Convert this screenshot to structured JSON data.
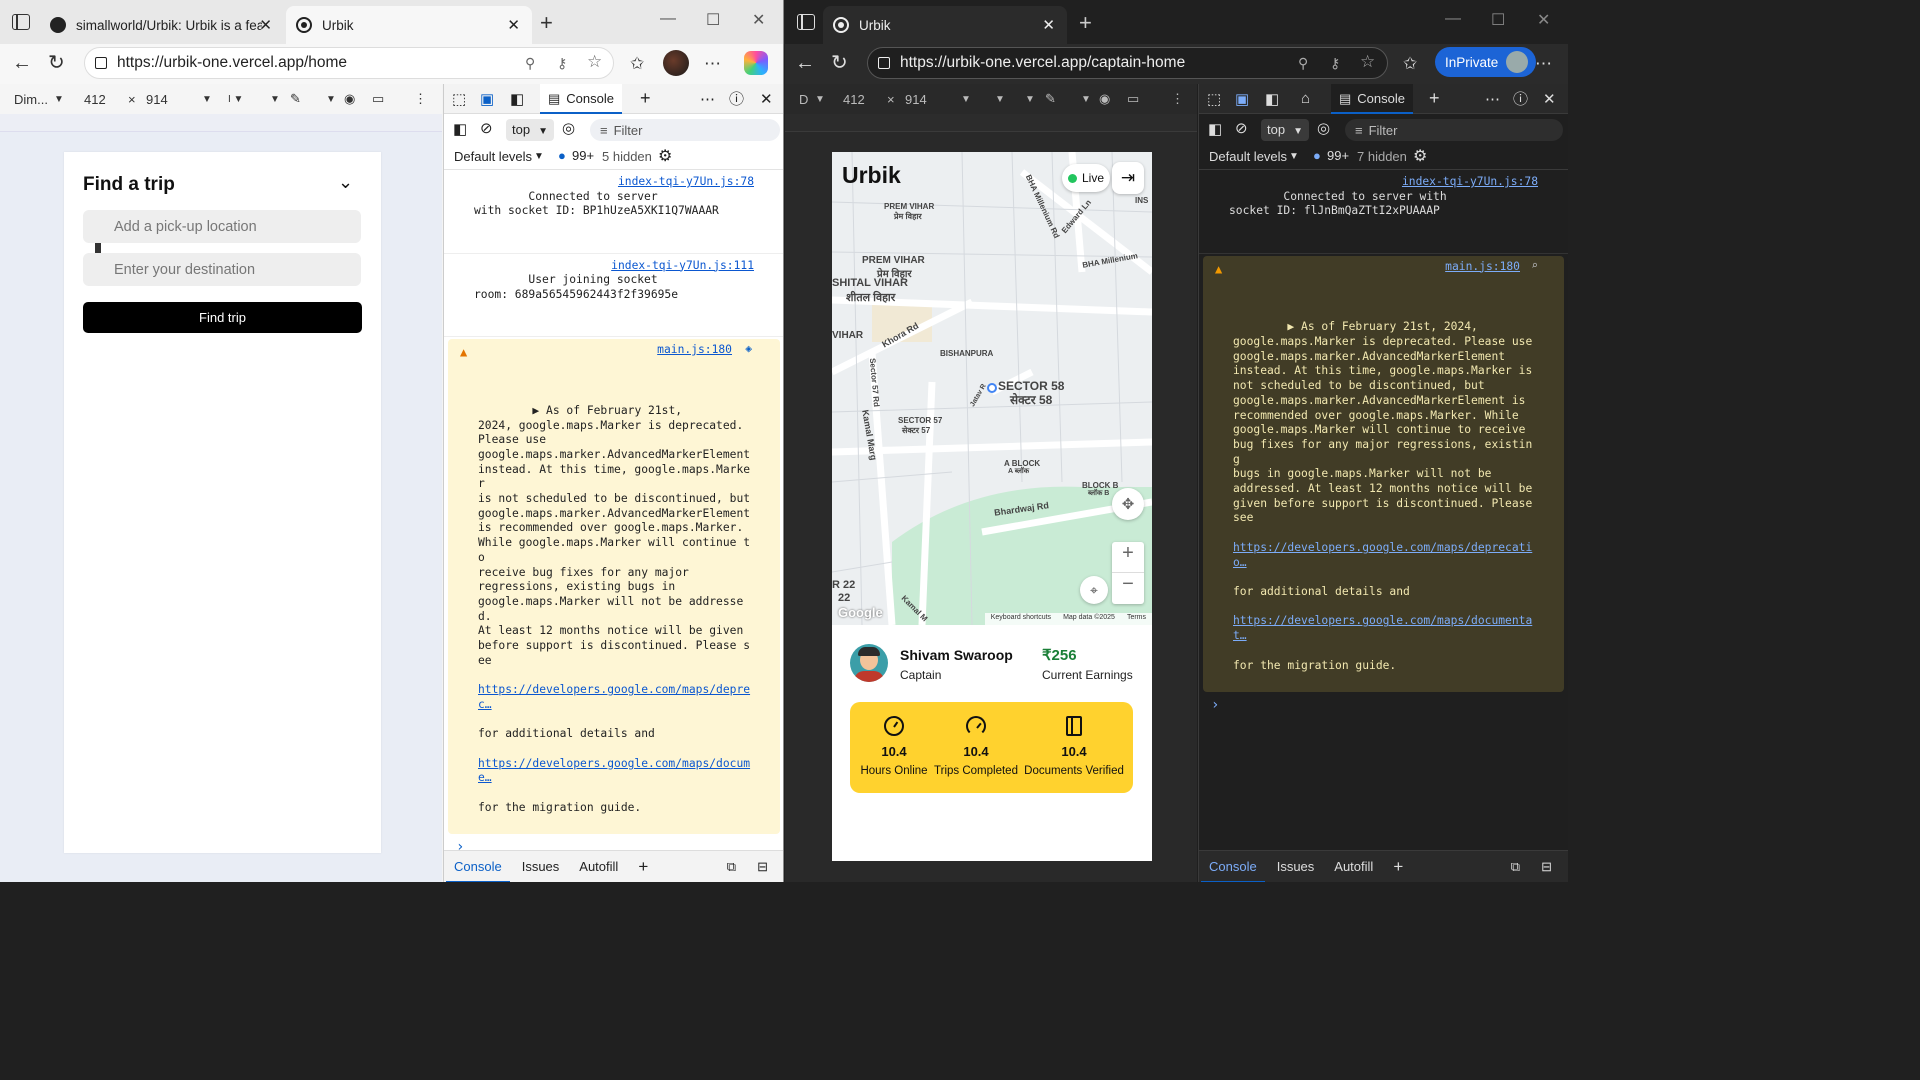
{
  "left_window": {
    "tabs": [
      {
        "title": "simallworld/Urbik: Urbik is a featu"
      },
      {
        "title": "Urbik"
      }
    ],
    "url": "https://urbik-one.vercel.app/home",
    "emulation": {
      "device": "Dim...",
      "width": "412",
      "height": "914"
    },
    "app": {
      "title": "Find a trip",
      "pickup_placeholder": "Add a pick-up location",
      "destination_placeholder": "Enter your destination",
      "button": "Find trip"
    },
    "devtools": {
      "panel": "Console",
      "context": "top",
      "filter_placeholder": "Filter",
      "levels": "Default levels",
      "count": "99+",
      "hidden": "5 hidden",
      "messages": [
        {
          "text": "Connected to server\nwith socket ID: BP1hUzeA5XKI1Q7WAAAR",
          "source": "index-tqi-y7Un.js:78"
        },
        {
          "text": "User joining socket\nroom: 689a56545962443f2f39695e",
          "source": "index-tqi-y7Un.js:111"
        }
      ],
      "warning": {
        "source": "main.js:180",
        "text": "▶ As of February 21st,\n2024, google.maps.Marker is deprecated.\nPlease use\ngoogle.maps.marker.AdvancedMarkerElement\ninstead. At this time, google.maps.Marker\nis not scheduled to be discontinued, but\ngoogle.maps.marker.AdvancedMarkerElement\nis recommended over google.maps.Marker.\nWhile google.maps.Marker will continue to\nreceive bug fixes for any major\nregressions, existing bugs in\ngoogle.maps.Marker will not be addressed.\nAt least 12 months notice will be given\nbefore support is discontinued. Please see",
        "link1": "https://developers.google.com/maps/deprec…",
        "mid": "for additional details and",
        "link2": "https://developers.google.com/maps/docume…",
        "end": "for the migration guide."
      },
      "drawer": [
        "Console",
        "Issues",
        "Autofill"
      ]
    }
  },
  "right_window": {
    "tabs": [
      {
        "title": "Urbik"
      }
    ],
    "url": "https://urbik-one.vercel.app/captain-home",
    "inprivate": "InPrivate",
    "emulation": {
      "device": "D",
      "width": "412",
      "height": "914"
    },
    "app": {
      "brand": "Urbik",
      "live": "Live",
      "map_labels": [
        "PREM VIHAR",
        "प्रेम विहार",
        "PREM VIHAR",
        "प्रेम विहार",
        "SHITAL VIHAR",
        "शीतल विहार",
        "VIHAR",
        "Khora Rd",
        "BISHANPURA",
        "SECTOR 58",
        "सेक्टर 58",
        "SECTOR 57",
        "सेक्टर 57",
        "A BLOCK",
        "A ब्लॉक",
        "BLOCK B",
        "ब्लॉक B",
        "Bhardwaj Rd",
        "Kamal Marg",
        "Sector 57 Rd",
        "BHA Millenium Rd",
        "BHA Millenium",
        "Edward Ln",
        "INS",
        "Jatav R",
        "R 22",
        "22",
        "Kamal M"
      ],
      "map_footer": [
        "Keyboard shortcuts",
        "Map data ©2025",
        "Terms"
      ],
      "google": "Google",
      "captain": {
        "name": "Shivam Swaroop",
        "role": "Captain",
        "earnings": "₹256",
        "earnings_label": "Current Earnings"
      },
      "stats": [
        {
          "value": "10.4",
          "label": "Hours Online",
          "icon": "clock-icon"
        },
        {
          "value": "10.4",
          "label": "Trips Completed",
          "icon": "speedometer-icon"
        },
        {
          "value": "10.4",
          "label": "Documents Verified",
          "icon": "notebook-icon"
        }
      ]
    },
    "devtools": {
      "panel": "Console",
      "context": "top",
      "filter_placeholder": "Filter",
      "levels": "Default levels",
      "count": "99+",
      "hidden": "7 hidden",
      "messages": [
        {
          "text": "Connected to server with\nsocket ID: flJnBmQaZTtI2xPUAAAP",
          "source": "index-tqi-y7Un.js:78"
        }
      ],
      "warning": {
        "source": "main.js:180",
        "text": "▶ As of February 21st, 2024,\ngoogle.maps.Marker is deprecated. Please use\ngoogle.maps.marker.AdvancedMarkerElement\ninstead. At this time, google.maps.Marker is\nnot scheduled to be discontinued, but\ngoogle.maps.marker.AdvancedMarkerElement is\nrecommended over google.maps.Marker. While\ngoogle.maps.Marker will continue to receive\nbug fixes for any major regressions, existing\nbugs in google.maps.Marker will not be\naddressed. At least 12 months notice will be\ngiven before support is discontinued. Please\nsee",
        "link1": "https://developers.google.com/maps/deprecatio…",
        "mid": "for additional details and",
        "link2": "https://developers.google.com/maps/documentat…",
        "end": "for the migration guide."
      },
      "drawer": [
        "Console",
        "Issues",
        "Autofill"
      ]
    }
  },
  "colors": {
    "accent": "#0b60c7",
    "warning_bg_light": "#fef6d5",
    "warning_bg_dark": "#413c26",
    "stats_bg": "#ffd22e",
    "earnings": "#1a7f37"
  }
}
